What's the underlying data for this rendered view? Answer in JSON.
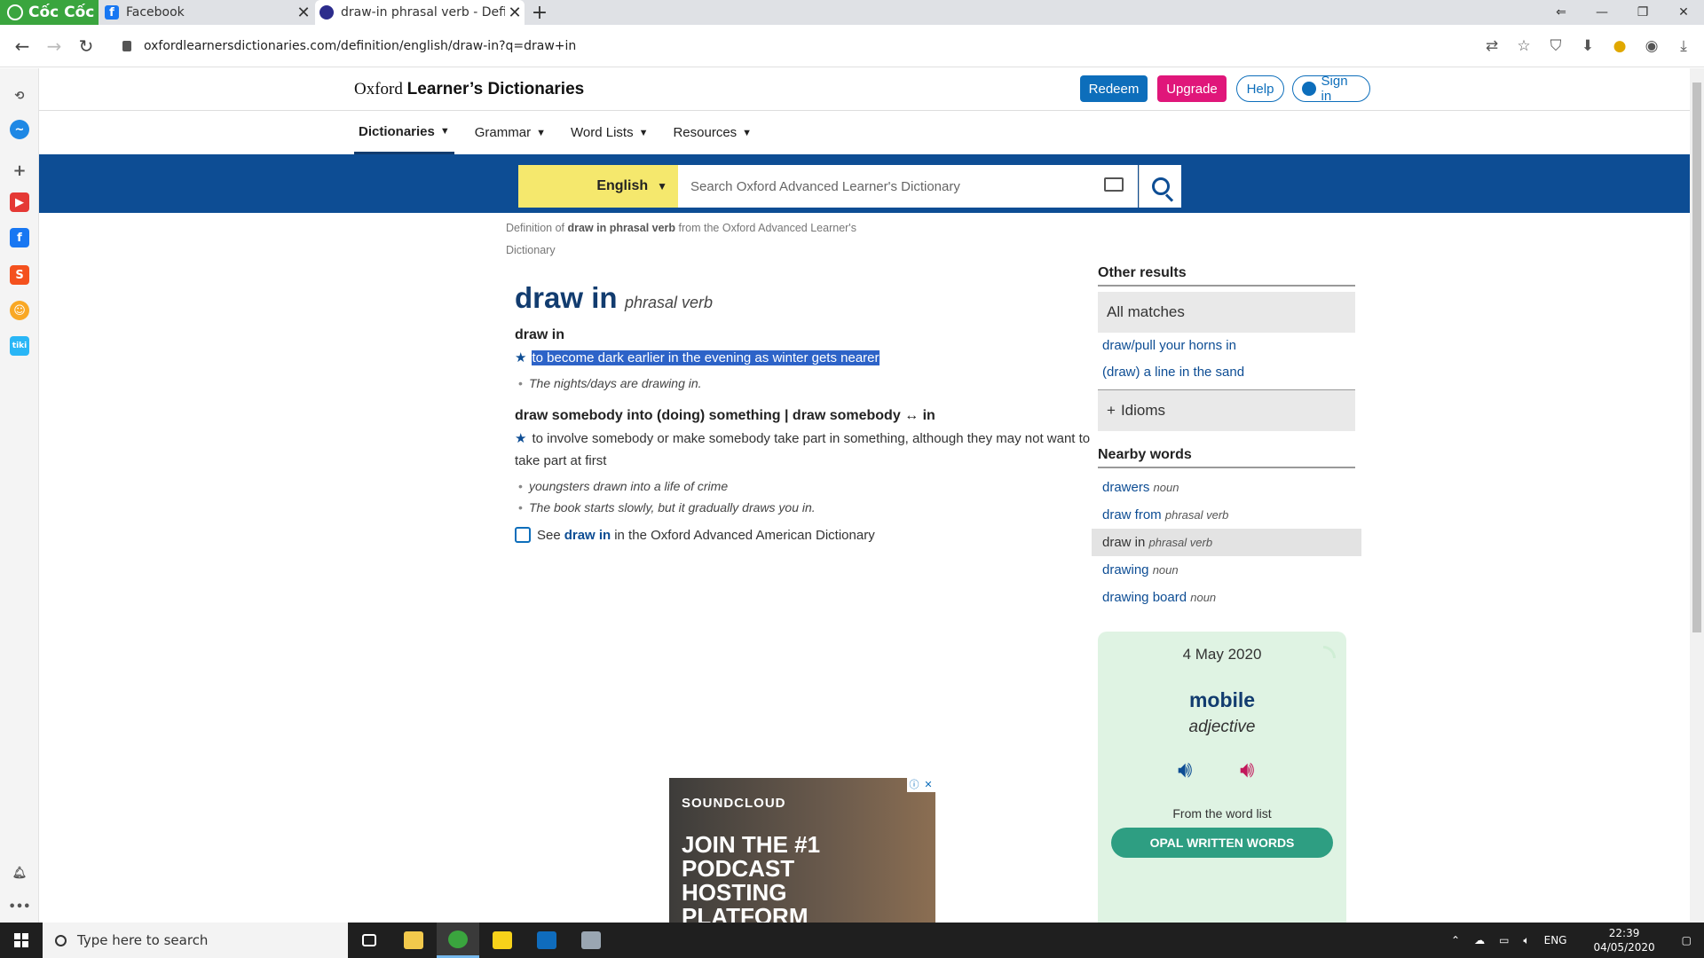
{
  "browser": {
    "brand": "Cốc Cốc",
    "tabs": [
      {
        "title": "Facebook",
        "favicon": "facebook-favicon",
        "active": false
      },
      {
        "title": "draw-in phrasal verb - Definit",
        "favicon": "oxford-favicon",
        "active": true
      }
    ],
    "url": "oxfordlearnersdictionaries.com/definition/english/draw-in?q=draw+in"
  },
  "site": {
    "title_prefix": "Oxford ",
    "title_bold": "Learner’s Dictionaries",
    "buttons": {
      "redeem": "Redeem",
      "upgrade": "Upgrade",
      "help": "Help",
      "signin": "Sign in"
    },
    "nav": [
      {
        "label": "Dictionaries",
        "active": true
      },
      {
        "label": "Grammar",
        "active": false
      },
      {
        "label": "Word Lists",
        "active": false
      },
      {
        "label": "Resources",
        "active": false
      }
    ],
    "search": {
      "language": "English",
      "placeholder": "Search Oxford Advanced Learner's Dictionary"
    }
  },
  "breadcrumb": {
    "prefix": "Definition of ",
    "term": "draw in phrasal verb",
    "suffix": " from the Oxford Advanced Learner's Dictionary"
  },
  "entry": {
    "headword": "draw in",
    "pos": "phrasal verb",
    "senses": [
      {
        "heading": "draw in",
        "definition": "to become dark earlier in the evening as winter gets nearer",
        "selected": true,
        "examples": [
          "The nights/days are drawing in."
        ]
      },
      {
        "heading": "draw somebody into (doing) something | draw somebody ↔ in",
        "definition": "to involve somebody or make somebody take part in something, although they may not want to take part at first",
        "selected": false,
        "examples": [
          "youngsters drawn into a life of crime",
          "The book starts slowly, but it gradually draws you in."
        ]
      }
    ],
    "see_also": {
      "see": "See",
      "link": "draw in",
      "rest": "in the Oxford Advanced American Dictionary"
    }
  },
  "ad": {
    "brand": "SOUNDCLOUD",
    "copy": "JOIN THE #1 PODCAST HOSTING PLATFORM"
  },
  "other_results": {
    "heading": "Other results",
    "all_matches": "All matches",
    "links": [
      "draw/pull your horns in",
      "(draw) a line in the sand"
    ],
    "idioms": "Idioms"
  },
  "nearby": {
    "heading": "Nearby words",
    "items": [
      {
        "word": "drawers",
        "pos": "noun",
        "current": false
      },
      {
        "word": "draw from",
        "pos": "phrasal verb",
        "current": false
      },
      {
        "word": "draw in",
        "pos": "phrasal verb",
        "current": true
      },
      {
        "word": "drawing",
        "pos": "noun",
        "current": false
      },
      {
        "word": "drawing board",
        "pos": "noun",
        "current": false
      }
    ]
  },
  "word_of_day": {
    "date": "4 May 2020",
    "word": "mobile",
    "pos": "adjective",
    "from": "From the word list",
    "list": "OPAL WRITTEN WORDS"
  },
  "taskbar": {
    "search_placeholder": "Type here to search",
    "lang": "ENG",
    "time": "22:39",
    "date": "04/05/2020"
  },
  "colors": {
    "brand_blue": "#0d4d94",
    "upgrade_pink": "#e0167a",
    "lang_yellow": "#f5e86d",
    "selection": "#2d63c8"
  }
}
